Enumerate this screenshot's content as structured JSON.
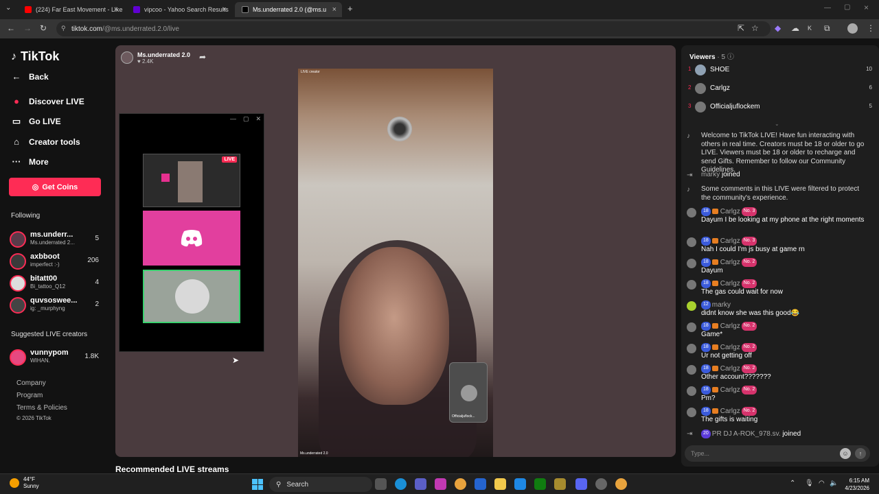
{
  "browser": {
    "tabs": [
      {
        "title": "(224) Far East Movement - Like",
        "color": "#ff0000"
      },
      {
        "title": "vipcoo - Yahoo Search Results",
        "color": "#6001d2"
      },
      {
        "title": "Ms.underrated 2.0 (@ms.u",
        "color": "#000000"
      }
    ],
    "new_tab": "+",
    "url_host": "tiktok.com",
    "url_path": "/@ms.underrated.2.0/live"
  },
  "sidebar": {
    "logo": "TikTok",
    "nav": [
      {
        "label": "Back",
        "icon": "←"
      },
      {
        "label": "Discover LIVE",
        "icon": "●"
      },
      {
        "label": "Go LIVE",
        "icon": "▭"
      },
      {
        "label": "Creator tools",
        "icon": "⌂"
      },
      {
        "label": "More",
        "icon": "···"
      }
    ],
    "get_coins": "Get Coins",
    "following_title": "Following",
    "following": [
      {
        "name": "ms.underr...",
        "sub": "Ms.underrated 2...",
        "count": "5"
      },
      {
        "name": "axbboot",
        "sub": "imperfect :-)",
        "count": "206"
      },
      {
        "name": "bitatt00",
        "sub": "Bi_tattoo_Q12",
        "count": "4"
      },
      {
        "name": "quvsoswee...",
        "sub": "ig: _murphyng",
        "count": "2"
      }
    ],
    "suggested_title": "Suggested LIVE creators",
    "suggested": [
      {
        "name": "vunnypom",
        "sub": "WIHAN.",
        "count": "1.8K"
      }
    ],
    "footer": [
      "Company",
      "Program",
      "Terms & Policies",
      "© 2026 TikTok"
    ]
  },
  "stream": {
    "host_name": "Ms.underrated 2.0",
    "host_likes": "♥ 2.4K",
    "video_tag": "LIVE creator",
    "video_bottom": "Ms.underrated 2.0",
    "guest_name": "Officialjuflock...",
    "pip_live": "LIVE",
    "recommended": "Recommended LIVE streams"
  },
  "panel": {
    "viewers_label": "Viewers",
    "viewers_count": "· 5",
    "viewers": [
      {
        "rank": "1",
        "name": "SHOE",
        "score": "10"
      },
      {
        "rank": "2",
        "name": "Carlgz",
        "score": "6"
      },
      {
        "rank": "3",
        "name": "Officialjuflockem",
        "score": "5"
      }
    ],
    "welcome": "Welcome to TikTok LIVE! Have fun interacting with others in real time. Creators must be 18 or older to go LIVE. Viewers must be 18 or older to recharge and send Gifts. Remember to follow our Community Guidelines.",
    "joined1_user": "marky",
    "joined_text": "joined",
    "filtered": "Some comments in this LIVE were filtered to protect the community's experience.",
    "messages": [
      {
        "lvl": "18",
        "user": "Carlgz",
        "rank": "No. 3",
        "text": "Dayum I be looking at my phone at the right moments"
      },
      {
        "lvl": "18",
        "user": "Carlgz",
        "rank": "No. 3",
        "text": "Nah I could I'm js busy at game rn"
      },
      {
        "lvl": "18",
        "user": "Carlgz",
        "rank": "No. 2",
        "text": "Dayum"
      },
      {
        "lvl": "18",
        "user": "Carlgz",
        "rank": "No. 2",
        "text": "The gas could wait for now"
      },
      {
        "lvl": "12",
        "user": "marky",
        "rank": "",
        "text": "didnt know she was this good😂"
      },
      {
        "lvl": "18",
        "user": "Carlgz",
        "rank": "No. 2",
        "text": "Game*"
      },
      {
        "lvl": "18",
        "user": "Carlgz",
        "rank": "No. 2",
        "text": "Ur not getting off"
      },
      {
        "lvl": "18",
        "user": "Carlgz",
        "rank": "No. 2",
        "text": "Other account???????"
      },
      {
        "lvl": "18",
        "user": "Carlgz",
        "rank": "No. 2",
        "text": "Pm?"
      },
      {
        "lvl": "18",
        "user": "Carlgz",
        "rank": "No. 2",
        "text": "The gifts is waiting"
      }
    ],
    "joined2_lvl": "20",
    "joined2_user": "PR DJ A-ROK_978.sv.",
    "input_placeholder": "Type..."
  },
  "taskbar": {
    "temp": "44°F",
    "condition": "Sunny",
    "search": "Search",
    "time": "6:15 AM",
    "date": "4/23/2026"
  },
  "colors": {
    "accent": "#fe2c55",
    "discord": "#e23f9e"
  }
}
